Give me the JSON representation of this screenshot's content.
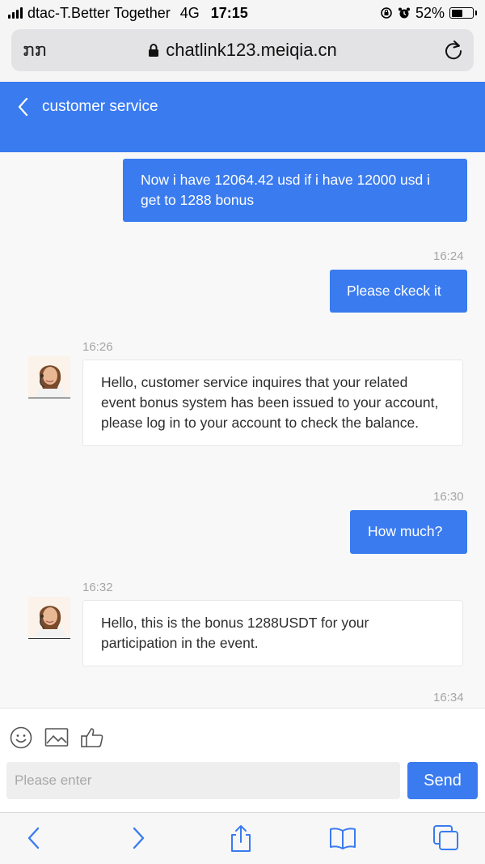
{
  "status_bar": {
    "carrier": "dtac-T.Better Together",
    "network": "4G",
    "time": "17:15",
    "battery_percent": "52%",
    "battery_level": 0.52
  },
  "browser": {
    "text_size_label": "ກກ",
    "url": "chatlink123.meiqia.cn"
  },
  "header": {
    "title": "customer service"
  },
  "messages": [
    {
      "side": "out",
      "text": "Now i have 12064.42 usd if i have 12000 usd i get to 1288 bonus"
    },
    {
      "side": "out",
      "time": "16:24",
      "text": "Please ckeck it"
    },
    {
      "side": "in",
      "time": "16:26",
      "text": "Hello, customer service inquires that your related event bonus system has been issued to your account, please log in to your account to check the balance."
    },
    {
      "side": "out",
      "time": "16:30",
      "text": "How much?"
    },
    {
      "side": "in",
      "time": "16:32",
      "text": "Hello, this is the bonus 1288USDT for your participation in the event."
    },
    {
      "side": "out",
      "time": "16:34"
    }
  ],
  "composer": {
    "placeholder": "Please enter",
    "send_label": "Send",
    "icons": [
      "emoji-icon",
      "image-icon",
      "thumbs-up-icon"
    ]
  },
  "colors": {
    "accent": "#3a7bf0"
  }
}
